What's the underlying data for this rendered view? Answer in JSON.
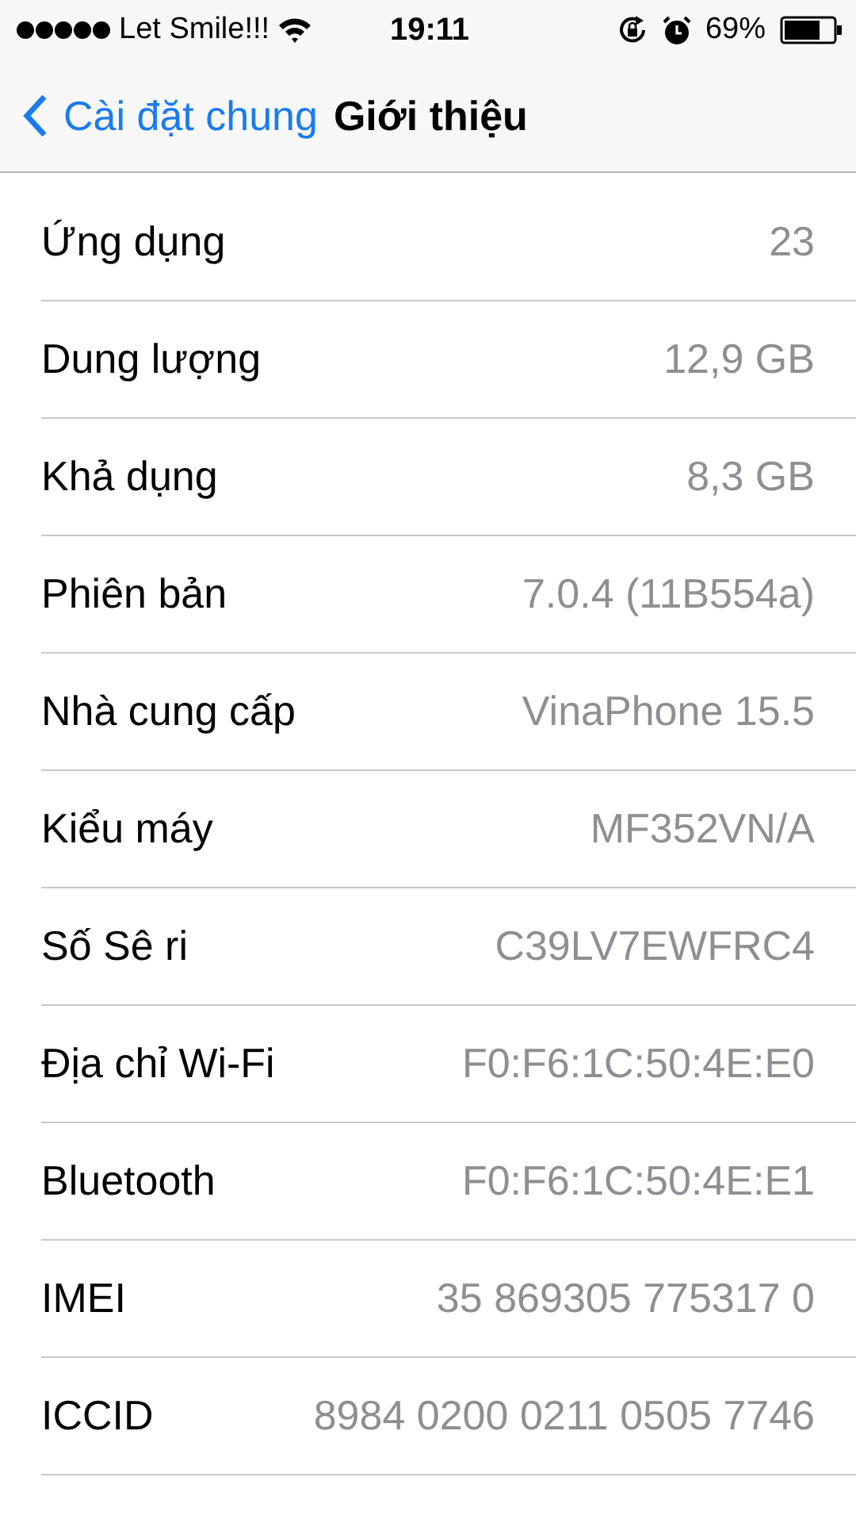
{
  "status_bar": {
    "carrier": "Let Smile!!!",
    "time": "19:11",
    "battery": "69%"
  },
  "nav": {
    "back": "Cài đặt chung",
    "title": "Giới thiệu"
  },
  "rows": [
    {
      "label": "Ứng dụng",
      "value": "23"
    },
    {
      "label": "Dung lượng",
      "value": "12,9 GB"
    },
    {
      "label": "Khả dụng",
      "value": "8,3 GB"
    },
    {
      "label": "Phiên bản",
      "value": "7.0.4 (11B554a)"
    },
    {
      "label": "Nhà cung cấp",
      "value": "VinaPhone 15.5"
    },
    {
      "label": "Kiểu máy",
      "value": "MF352VN/A"
    },
    {
      "label": "Số Sê ri",
      "value": "C39LV7EWFRC4"
    },
    {
      "label": "Địa chỉ Wi-Fi",
      "value": "F0:F6:1C:50:4E:E0"
    },
    {
      "label": "Bluetooth",
      "value": "F0:F6:1C:50:4E:E1"
    },
    {
      "label": "IMEI",
      "value": "35 869305 775317 0"
    },
    {
      "label": "ICCID",
      "value": "8984 0200 0211 0505 7746"
    }
  ]
}
